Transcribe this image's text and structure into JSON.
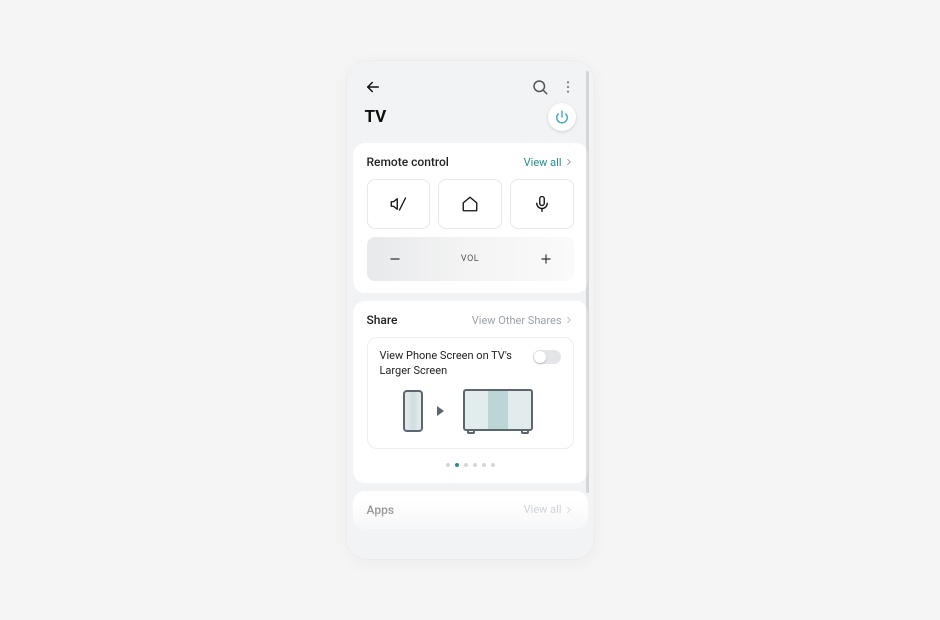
{
  "header": {
    "title": "TV"
  },
  "remote": {
    "section_title": "Remote control",
    "view_all_label": "View all",
    "volume_label": "VOL"
  },
  "share": {
    "section_title": "Share",
    "view_link_label": "View Other Shares",
    "description": "View Phone Screen on TV's Larger Screen",
    "toggle_on": false,
    "carousel_active_index": 1,
    "carousel_count": 6
  },
  "apps": {
    "section_title": "Apps",
    "view_all_label": "View all"
  },
  "colors": {
    "accent": "#268d8d",
    "power_icon": "#2aa3b7"
  }
}
